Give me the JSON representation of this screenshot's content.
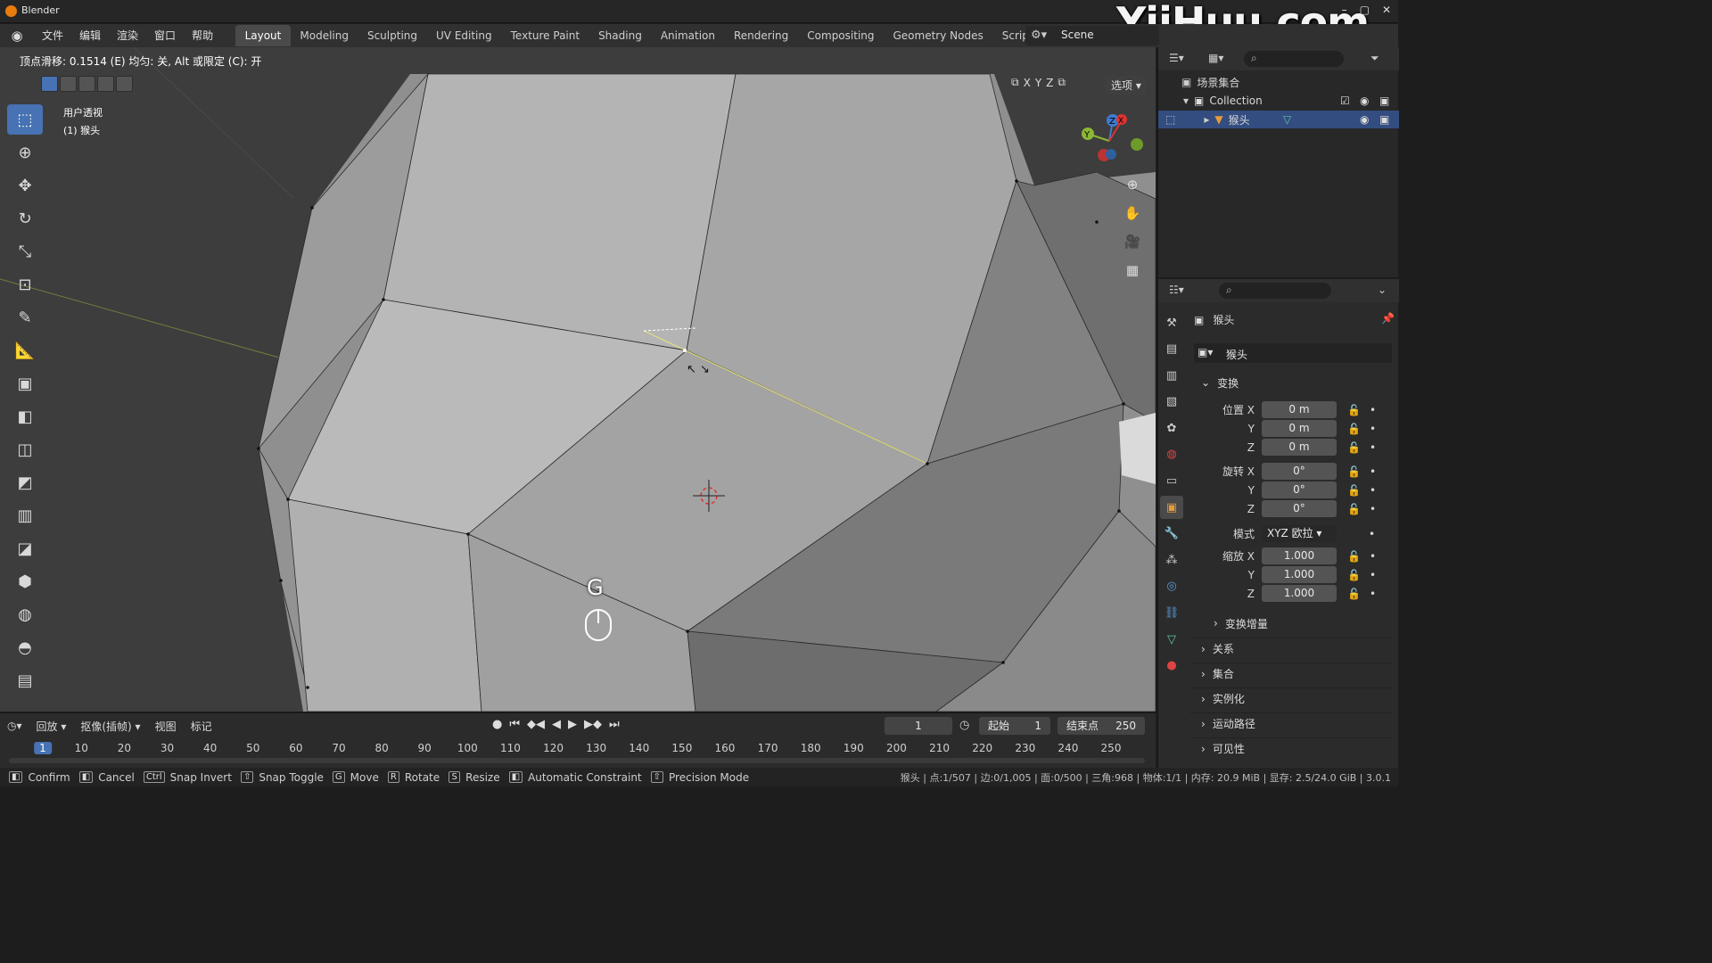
{
  "window": {
    "title": "Blender",
    "watermark": "YiiHuu.com"
  },
  "menu": {
    "items": [
      "文件",
      "编辑",
      "渲染",
      "窗口",
      "帮助"
    ]
  },
  "workspaces": [
    "Layout",
    "Modeling",
    "Sculpting",
    "UV Editing",
    "Texture Paint",
    "Shading",
    "Animation",
    "Rendering",
    "Compositing",
    "Geometry Nodes",
    "Scripting"
  ],
  "active_workspace": "Layout",
  "scene": {
    "name": "Scene"
  },
  "viewport": {
    "status_hint": "顶点滑移: 0.1514 (E) 均匀: 关, Alt 或限定 (C): 开",
    "view_name": "用户透视",
    "object_label": "(1) 猴头",
    "options_label": "选项",
    "axis": [
      "X",
      "Y",
      "Z"
    ],
    "key_overlay": "G"
  },
  "timeline": {
    "playback_label": "回放",
    "keying_label": "抠像(插帧)",
    "view_label": "视图",
    "marker_label": "标记",
    "current_frame": "1",
    "start_label": "起始",
    "start_value": "1",
    "end_label": "结束点",
    "end_value": "250",
    "ticks": [
      "1",
      "10",
      "20",
      "30",
      "40",
      "50",
      "60",
      "70",
      "80",
      "90",
      "100",
      "110",
      "120",
      "130",
      "140",
      "150",
      "160",
      "170",
      "180",
      "190",
      "200",
      "210",
      "220",
      "230",
      "240",
      "250"
    ]
  },
  "statusbar": {
    "items": [
      {
        "key": "",
        "label": "Confirm"
      },
      {
        "key": "",
        "label": "Cancel"
      },
      {
        "key": "Ctrl",
        "label": "Snap Invert"
      },
      {
        "key": "⇧",
        "label": "Snap Toggle"
      },
      {
        "key": "G",
        "label": "Move"
      },
      {
        "key": "R",
        "label": "Rotate"
      },
      {
        "key": "S",
        "label": "Resize"
      },
      {
        "key": "",
        "label": "Automatic Constraint"
      },
      {
        "key": "⇧",
        "label": "Precision Mode"
      }
    ],
    "stats": "猴头 | 点:1/507 | 边:0/1,005 | 面:0/500 | 三角:968 | 物体:1/1 | 内存: 20.9 MiB | 显存: 2.5/24.0 GiB | 3.0.1"
  },
  "outliner": {
    "scene_collection": "场景集合",
    "collection": "Collection",
    "object": "猴头"
  },
  "properties": {
    "object_name": "猴头",
    "data_name": "猴头",
    "transform_title": "变换",
    "location_label": "位置 X",
    "rotation_label": "旋转 X",
    "mode_label": "模式",
    "mode_value": "XYZ 欧拉",
    "scale_label": "缩放 X",
    "y_label": "Y",
    "z_label": "Z",
    "location": [
      "0 m",
      "0 m",
      "0 m"
    ],
    "rotation": [
      "0°",
      "0°",
      "0°"
    ],
    "scale": [
      "1.000",
      "1.000",
      "1.000"
    ],
    "delta_title": "变换增量",
    "sections": [
      "关系",
      "集合",
      "实例化",
      "运动路径",
      "可见性"
    ]
  },
  "colors": {
    "accent": "#4772b3",
    "selected_row": "#334d80",
    "edge_highlight": "#e8e37a"
  }
}
